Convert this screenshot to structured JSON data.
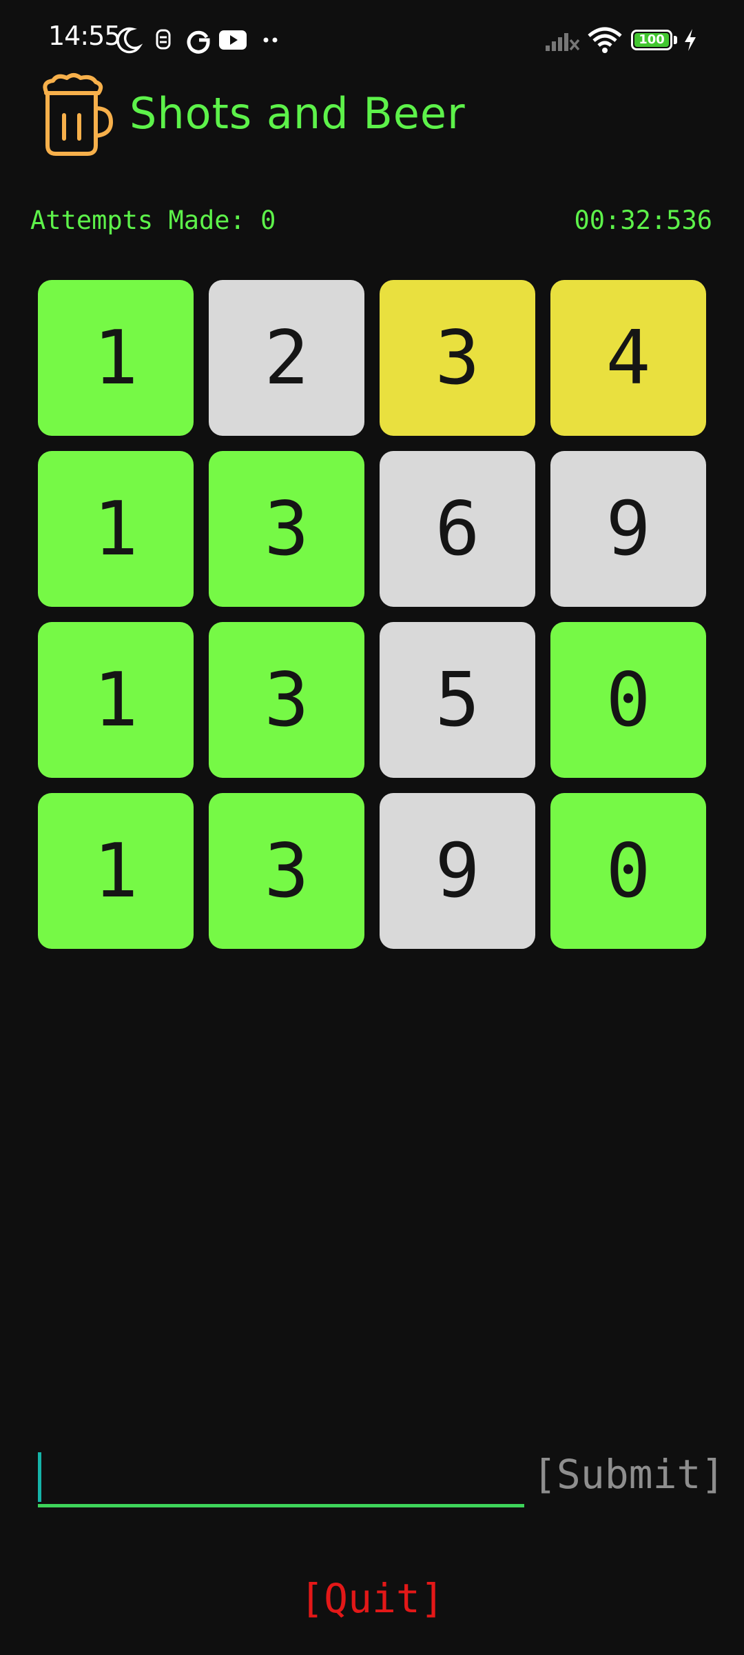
{
  "status_bar": {
    "time": "14:55",
    "battery_level": "100",
    "icons": [
      "moon-icon",
      "notification-icon",
      "google-icon",
      "youtube-icon",
      "more-dots-icon",
      "signal-icon",
      "wifi-icon",
      "battery-icon",
      "charging-icon"
    ]
  },
  "app": {
    "title": "Shots and Beer",
    "logo_icon": "beer-mug-icon",
    "title_color": "#5df24a",
    "logo_color": "#f7b04b"
  },
  "stats": {
    "attempts_label": "Attempts Made: 0",
    "timer": "00:32:536"
  },
  "board": {
    "colors": {
      "green": "#76f946",
      "yellow": "#e9e03f",
      "gray": "#d9d9d9"
    },
    "rows": [
      [
        {
          "digit": "1",
          "state": "green"
        },
        {
          "digit": "2",
          "state": "gray"
        },
        {
          "digit": "3",
          "state": "yellow"
        },
        {
          "digit": "4",
          "state": "yellow"
        }
      ],
      [
        {
          "digit": "1",
          "state": "green"
        },
        {
          "digit": "3",
          "state": "green"
        },
        {
          "digit": "6",
          "state": "gray"
        },
        {
          "digit": "9",
          "state": "gray"
        }
      ],
      [
        {
          "digit": "1",
          "state": "green"
        },
        {
          "digit": "3",
          "state": "green"
        },
        {
          "digit": "5",
          "state": "gray"
        },
        {
          "digit": "0",
          "state": "green"
        }
      ],
      [
        {
          "digit": "1",
          "state": "green"
        },
        {
          "digit": "3",
          "state": "green"
        },
        {
          "digit": "9",
          "state": "gray"
        },
        {
          "digit": "0",
          "state": "green"
        }
      ]
    ]
  },
  "input": {
    "value": "",
    "placeholder": "",
    "submit_label": "[Submit]"
  },
  "quit_label": "[Quit]"
}
